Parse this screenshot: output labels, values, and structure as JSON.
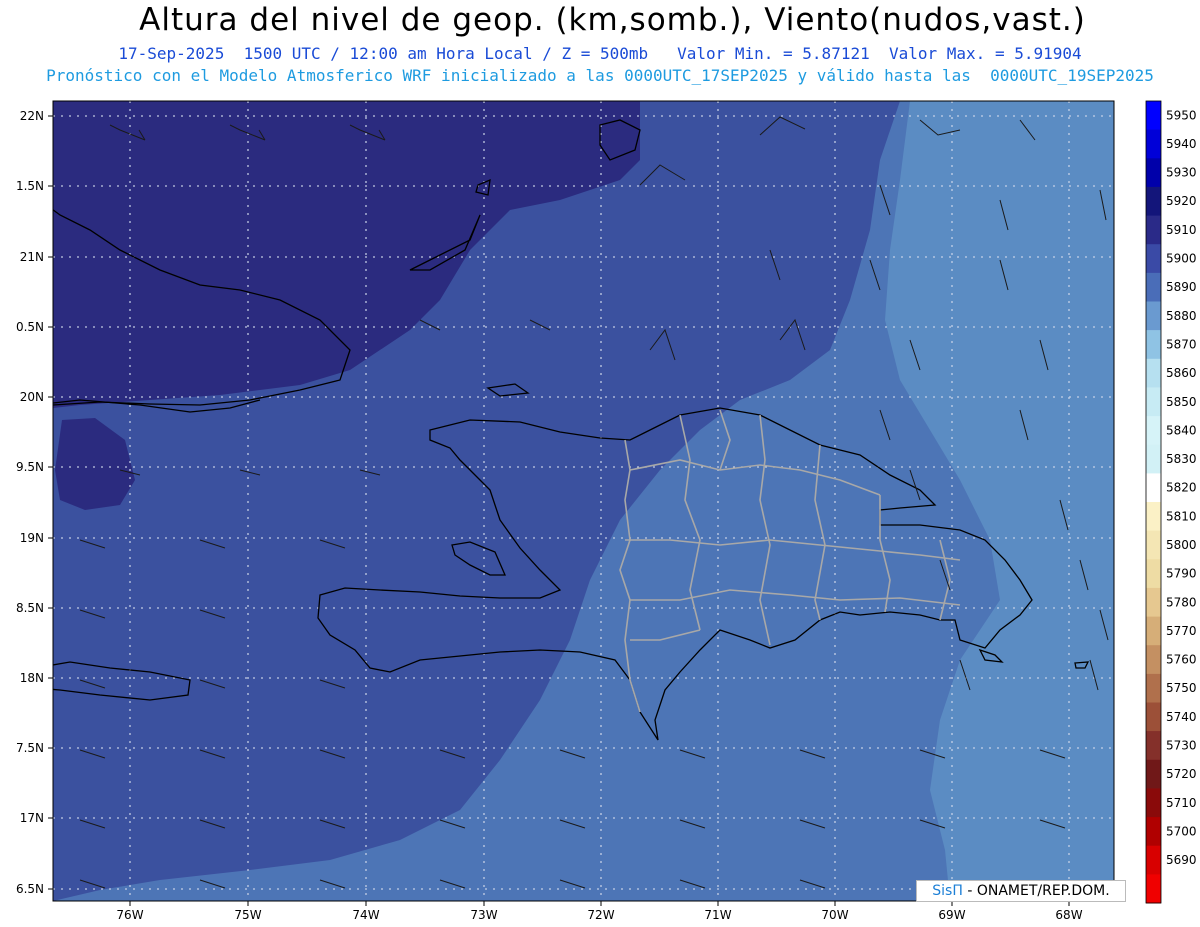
{
  "title": "Altura del nivel de geop. (km,somb.), Viento(nudos,vast.)",
  "subtitle_line1": "17-Sep-2025  1500 UTC / 12:00 am Hora Local / Z = 500mb   Valor Min. = 5.87121  Valor Max. = 5.91904",
  "subtitle_line2": "Pronóstico con el Modelo Atmosferico WRF inicializado a las 0000UTC_17SEP2025 y válido hasta las  0000UTC_19SEP2025",
  "credit": {
    "brand": "SisΠ",
    "text": "- ONAMET/REP.DOM."
  },
  "lat_labels": [
    "22N",
    "1.5N",
    "21N",
    "0.5N",
    "20N",
    "9.5N",
    "19N",
    "8.5N",
    "18N",
    "7.5N",
    "17N",
    "6.5N"
  ],
  "lon_labels": [
    "76W",
    "75W",
    "74W",
    "73W",
    "72W",
    "71W",
    "70W",
    "69W",
    "68W"
  ],
  "colorbar": {
    "levels": [
      5950,
      5940,
      5930,
      5920,
      5910,
      5900,
      5890,
      5880,
      5870,
      5860,
      5850,
      5840,
      5830,
      5820,
      5810,
      5800,
      5790,
      5780,
      5770,
      5760,
      5750,
      5740,
      5730,
      5720,
      5710,
      5700,
      5690
    ],
    "colors": [
      "#0000ff",
      "#0000d8",
      "#0000aa",
      "#13157a",
      "#2a2a88",
      "#3a4aa6",
      "#4a6db8",
      "#6a9ad0",
      "#8fc3e4",
      "#b6e0f0",
      "#c7ebf4",
      "#d6f3f8",
      "#d2f1f6",
      "#ffffff",
      "#fbf1c6",
      "#f4e6b4",
      "#eedca4",
      "#e6c890",
      "#d6ae78",
      "#c49062",
      "#b0704c",
      "#9c5038",
      "#84302a",
      "#701818",
      "#8a0a0a",
      "#b00000",
      "#d80000",
      "#f00000"
    ]
  },
  "colors": {
    "zone_dark": "#2b2b7f",
    "zone_mid": "#3b519f",
    "zone_light": "#4d75b6",
    "zone_lighter": "#5b8cc3",
    "coast": "#000000",
    "province": "#a8a8a8"
  }
}
